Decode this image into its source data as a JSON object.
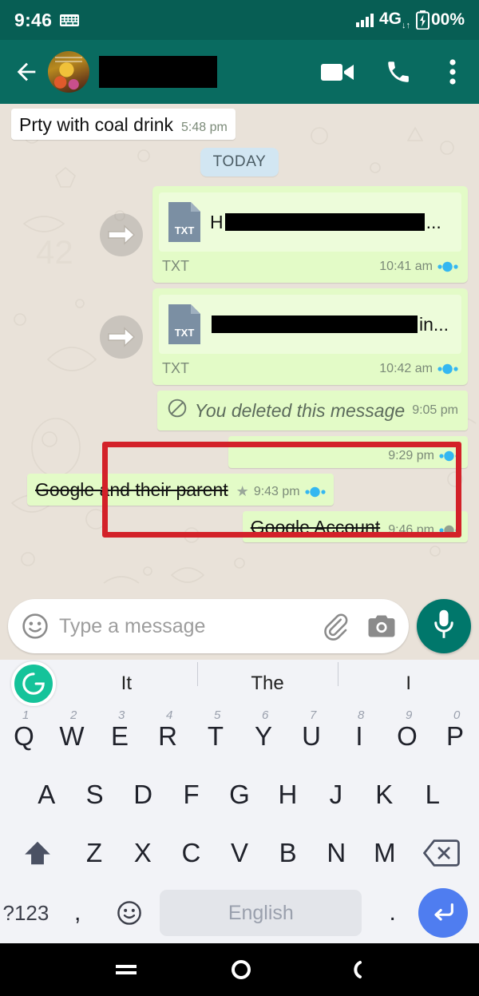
{
  "status_bar": {
    "time": "9:46",
    "keyboard_icon": "keyboard-icon",
    "signal_icon": "signal-bars-icon",
    "network": "4G",
    "network_sub": "↓↑",
    "battery_icon": "battery-charging-icon",
    "battery_level": "00%"
  },
  "app_bar": {
    "back_icon": "back-arrow-icon",
    "avatar": "contact-avatar",
    "contact_name": "",
    "video_call_icon": "video-camera-icon",
    "voice_call_icon": "phone-icon",
    "overflow_icon": "three-dot-menu-icon"
  },
  "chat": {
    "day_divider": "TODAY",
    "messages": [
      {
        "id": "msg-party",
        "direction": "in",
        "type": "text",
        "text": "Prty with coal drink",
        "time": "5:48 pm",
        "starred": false,
        "strikethrough": false,
        "ticks": "none"
      },
      {
        "id": "msg-doc-1",
        "direction": "out",
        "type": "document",
        "forwarded": true,
        "forward_icon": "forward-arrow-icon",
        "doc_icon": "txt-file-icon",
        "doc_icon_label": "TXT",
        "title_prefix": "H",
        "title_suffix": "...",
        "file_type": "TXT",
        "time": "10:41 am",
        "ticks": "read"
      },
      {
        "id": "msg-doc-2",
        "direction": "out",
        "type": "document",
        "forwarded": true,
        "forward_icon": "forward-arrow-icon",
        "doc_icon": "txt-file-icon",
        "doc_icon_label": "TXT",
        "title_prefix": "",
        "title_suffix": "in...",
        "file_type": "TXT",
        "time": "10:42 am",
        "ticks": "read"
      },
      {
        "id": "msg-deleted",
        "direction": "out",
        "type": "deleted",
        "icon": "blocked-circle-icon",
        "text": "You deleted this message",
        "time": "9:05 pm",
        "ticks": "none"
      },
      {
        "id": "msg-blank",
        "direction": "out",
        "type": "text",
        "text": "",
        "time": "9:29 pm",
        "ticks": "read"
      },
      {
        "id": "msg-google-parent",
        "direction": "out",
        "type": "text",
        "text": "Google and their parent",
        "time": "9:43 pm",
        "starred": true,
        "star_icon": "star-icon",
        "strikethrough": true,
        "ticks": "read"
      },
      {
        "id": "msg-google-account",
        "direction": "out",
        "type": "text",
        "text": "Google Account",
        "time": "9:46 pm",
        "starred": false,
        "strikethrough": true,
        "ticks": "delivered"
      }
    ],
    "highlight_box_color": "#d32129"
  },
  "input_bar": {
    "emoji_icon": "emoji-smiley-icon",
    "placeholder": "Type a message",
    "attach_icon": "paperclip-icon",
    "camera_icon": "camera-icon",
    "mic_icon": "microphone-icon"
  },
  "keyboard": {
    "assistant_icon": "grammarly-logo-icon",
    "suggestions": [
      "It",
      "The",
      "I"
    ],
    "row1": [
      {
        "key": "Q",
        "num": "1"
      },
      {
        "key": "W",
        "num": "2"
      },
      {
        "key": "E",
        "num": "3"
      },
      {
        "key": "R",
        "num": "4"
      },
      {
        "key": "T",
        "num": "5"
      },
      {
        "key": "Y",
        "num": "6"
      },
      {
        "key": "U",
        "num": "7"
      },
      {
        "key": "I",
        "num": "8"
      },
      {
        "key": "O",
        "num": "9"
      },
      {
        "key": "P",
        "num": "0"
      }
    ],
    "row2": [
      "A",
      "S",
      "D",
      "F",
      "G",
      "H",
      "J",
      "K",
      "L"
    ],
    "row3": {
      "shift_icon": "shift-arrow-icon",
      "keys": [
        "Z",
        "X",
        "C",
        "V",
        "B",
        "N",
        "M"
      ],
      "backspace_icon": "backspace-icon"
    },
    "row4": {
      "symbols_label": "?123",
      "comma": ",",
      "emoji_icon": "emoji-smiley-icon",
      "space_label": "English",
      "period": ".",
      "enter_icon": "enter-return-icon"
    }
  },
  "nav_bar": {
    "recents_icon": "recents-icon",
    "home_icon": "home-circle-icon",
    "back_icon": "back-c-icon"
  },
  "colors": {
    "status_bar": "#075e54",
    "app_bar": "#096b60",
    "chat_bg": "#e9e2d9",
    "outgoing_bubble": "#e3fbc7",
    "incoming_bubble": "#ffffff",
    "highlight": "#d32129",
    "tick_read": "#34b7f1",
    "tick_delivered": "#92a08f",
    "mic_button": "#00776b",
    "enter_button": "#4f7df0",
    "grammarly": "#15c39a"
  }
}
